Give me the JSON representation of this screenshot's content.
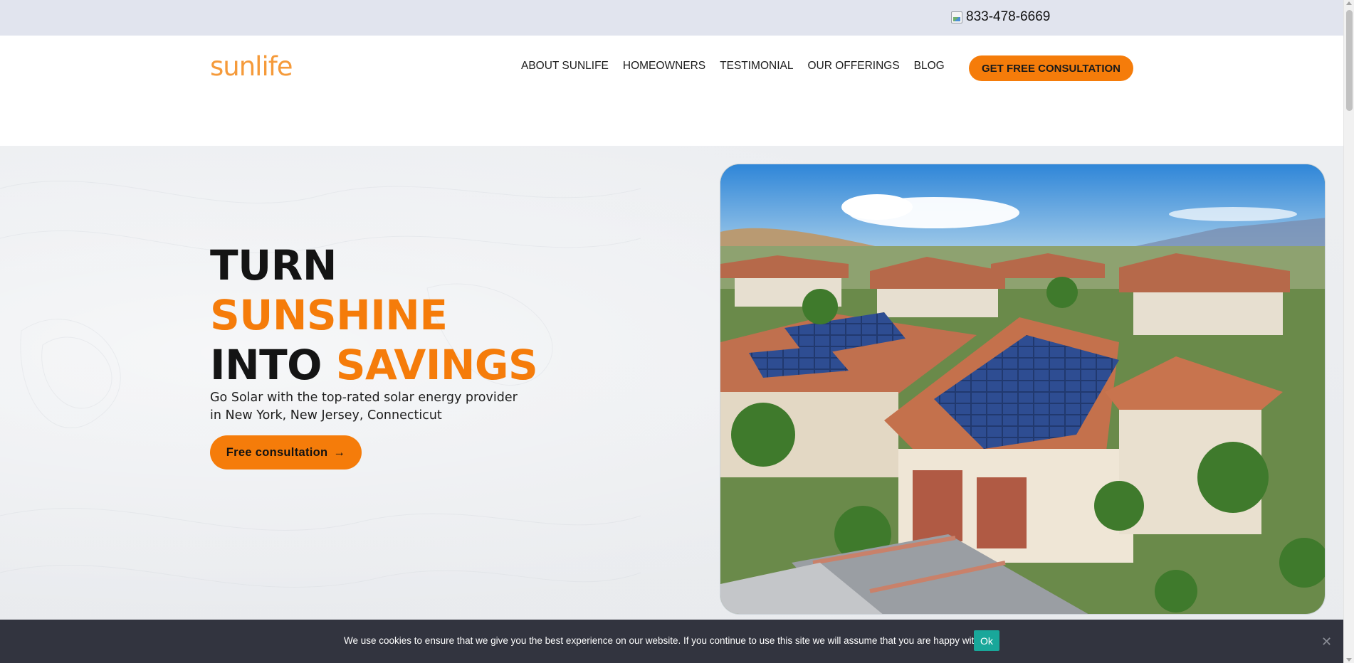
{
  "topbar": {
    "phone": "833-478-6669",
    "phone_icon": "broken-image-icon"
  },
  "header": {
    "logo": "sunlife",
    "nav": [
      {
        "label": "ABOUT SUNLIFE"
      },
      {
        "label": "HOMEOWNERS"
      },
      {
        "label": "TESTIMONIAL"
      },
      {
        "label": "OUR OFFERINGS"
      },
      {
        "label": "BLOG"
      }
    ],
    "cta_label": "GET FREE CONSULTATION"
  },
  "hero": {
    "line1": "TURN",
    "line2": "SUNSHINE",
    "line3_a": "INTO",
    "line3_b": "SAVINGS",
    "subtitle_1": "Go Solar with the top-rated solar energy provider",
    "subtitle_2": "in New York, New Jersey, Connecticut",
    "cta_label": "Free consultation",
    "cta_arrow": "→"
  },
  "cookie": {
    "text": "We use cookies to ensure that we give you the best experience on our website. If you continue to use this site we will assume that you are happy with it.",
    "ok_label": "Ok",
    "close_glyph": "✕"
  },
  "colors": {
    "accent": "#f57c0a",
    "logo": "#f59a3a",
    "topbar_bg": "#e1e4ee",
    "cookie_bg": "#32343f",
    "cookie_ok": "#19a79a"
  }
}
